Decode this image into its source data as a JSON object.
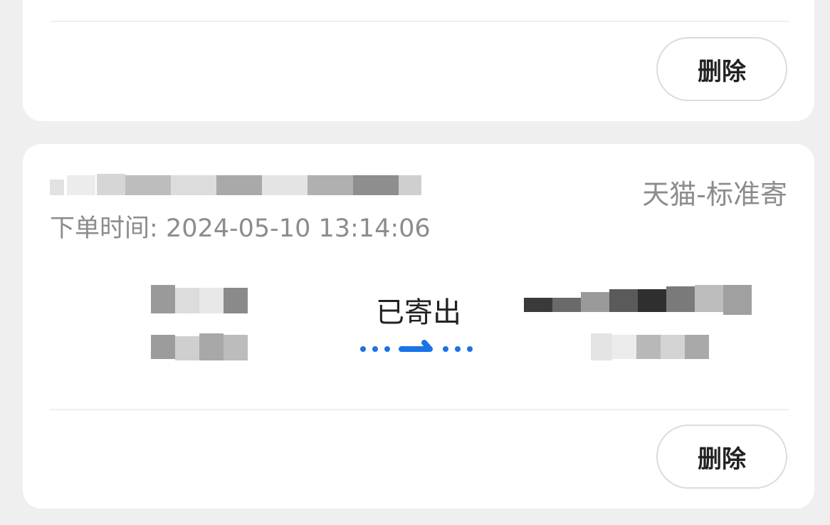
{
  "cards": [
    {
      "delete_label": "删除"
    },
    {
      "service_type": "天猫-标准寄",
      "order_time_label": "下单时间:",
      "order_time_value": "2024-05-10 13:14:06",
      "status": "已寄出",
      "delete_label": "删除",
      "accent_color": "#1a73e8"
    }
  ],
  "icons": {
    "status_arrow": "dotted-right-arrow-icon"
  }
}
